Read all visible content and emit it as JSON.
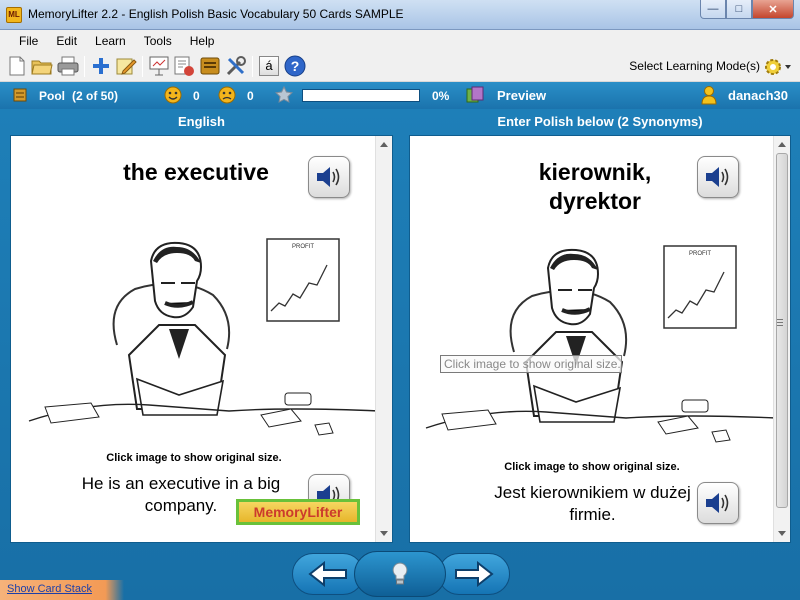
{
  "window": {
    "app_icon_text": "ML",
    "title": "MemoryLifter 2.2 - English Polish Basic Vocabulary 50 Cards SAMPLE"
  },
  "menu": [
    "File",
    "Edit",
    "Learn",
    "Tools",
    "Help"
  ],
  "toolbar": {
    "mode_label": "Select Learning Mode(s)",
    "accent_char": "á"
  },
  "status": {
    "pool_label": "Pool",
    "pool_count": "(2 of 50)",
    "right_count": "0",
    "wrong_count": "0",
    "progress_percent": 0,
    "progress_text": "0%",
    "preview_label": "Preview",
    "username": "danach30"
  },
  "question": {
    "language_header": "English",
    "word": "the executive",
    "image_hint": "Click image to show original size.",
    "example": "He is an executive in a big company.",
    "logo_text": "MemoryLifter"
  },
  "answer": {
    "header": "Enter Polish below (2 Synonyms)",
    "word": "kierownik, dyrektor",
    "image_hint": "Click image to show original size.",
    "example": "Jest kierownikiem w dużej firmie.",
    "tooltip": "Click image to show original size."
  },
  "illustration": {
    "chart_caption": "PROFIT"
  },
  "footer": {
    "show_card_stack": "Show Card Stack"
  },
  "colors": {
    "main_blue": "#1e7fb8",
    "status_blue": "#2a8fc8"
  }
}
